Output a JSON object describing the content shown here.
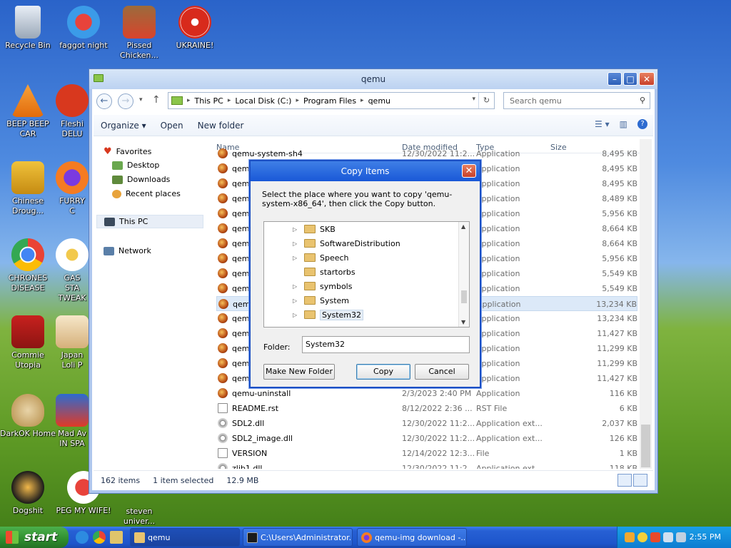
{
  "desktop": {
    "icons": [
      {
        "label": "Recycle Bin"
      },
      {
        "label": "faggot night"
      },
      {
        "label": "Pissed Chicken..."
      },
      {
        "label": "UKRAINE!"
      },
      {
        "label": "BEEP BEEP CAR"
      },
      {
        "label": "Fleshi DELU"
      },
      {
        "label": "Chinese Droug..."
      },
      {
        "label": "FURRY C"
      },
      {
        "label": "CHRONES DISEASE"
      },
      {
        "label": "GAS STA TWEAK"
      },
      {
        "label": "Commie Utopia"
      },
      {
        "label": "Japan Loli P"
      },
      {
        "label": "DarkOK Home"
      },
      {
        "label": "Mad Av IN SPA"
      },
      {
        "label": "Dogshit"
      },
      {
        "label": "PEG MY WIFE!"
      },
      {
        "label": "steven univer..."
      }
    ]
  },
  "explorer": {
    "title": "qemu",
    "breadcrumbs": [
      "This PC",
      "Local Disk (C:)",
      "Program Files",
      "qemu"
    ],
    "search_placeholder": "Search qemu",
    "toolbar": {
      "organize": "Organize",
      "open": "Open",
      "new_folder": "New folder"
    },
    "nav": {
      "favorites": "Favorites",
      "desktop": "Desktop",
      "downloads": "Downloads",
      "recent": "Recent places",
      "this_pc": "This PC",
      "network": "Network"
    },
    "columns": {
      "name": "Name",
      "date": "Date modified",
      "type": "Type",
      "size": "Size"
    },
    "rows": [
      {
        "name": "qemu-system-sh4",
        "date": "12/30/2022 11:2...",
        "type": "Application",
        "size": "8,495 KB",
        "icon": "qemu"
      },
      {
        "name": "qemu",
        "date": "",
        "type": "Application",
        "size": "8,495 KB",
        "icon": "qemu"
      },
      {
        "name": "qemu",
        "date": "",
        "type": "Application",
        "size": "8,495 KB",
        "icon": "qemu"
      },
      {
        "name": "qemu",
        "date": "",
        "type": "Application",
        "size": "8,489 KB",
        "icon": "qemu"
      },
      {
        "name": "qemu",
        "date": "",
        "type": "Application",
        "size": "5,956 KB",
        "icon": "qemu"
      },
      {
        "name": "qemu",
        "date": "",
        "type": "Application",
        "size": "8,664 KB",
        "icon": "qemu"
      },
      {
        "name": "qemu",
        "date": "",
        "type": "Application",
        "size": "8,664 KB",
        "icon": "qemu"
      },
      {
        "name": "qemu",
        "date": "",
        "type": "Application",
        "size": "5,956 KB",
        "icon": "qemu"
      },
      {
        "name": "qemu",
        "date": "",
        "type": "Application",
        "size": "5,549 KB",
        "icon": "qemu"
      },
      {
        "name": "qemu",
        "date": "",
        "type": "Application",
        "size": "5,549 KB",
        "icon": "qemu"
      },
      {
        "name": "qemu",
        "date": "",
        "type": "Application",
        "size": "13,234 KB",
        "icon": "qemu",
        "selected": true
      },
      {
        "name": "qemu",
        "date": "",
        "type": "Application",
        "size": "13,234 KB",
        "icon": "qemu"
      },
      {
        "name": "qemu",
        "date": "",
        "type": "Application",
        "size": "11,427 KB",
        "icon": "qemu"
      },
      {
        "name": "qemu",
        "date": "",
        "type": "Application",
        "size": "11,299 KB",
        "icon": "qemu"
      },
      {
        "name": "qemu",
        "date": "",
        "type": "Application",
        "size": "11,299 KB",
        "icon": "qemu"
      },
      {
        "name": "qemu",
        "date": "",
        "type": "Application",
        "size": "11,427 KB",
        "icon": "qemu"
      },
      {
        "name": "qemu-uninstall",
        "date": "2/3/2023 2:40 PM",
        "type": "Application",
        "size": "116 KB",
        "icon": "qemu"
      },
      {
        "name": "README.rst",
        "date": "8/12/2022 2:36 ...",
        "type": "RST File",
        "size": "6 KB",
        "icon": "doc"
      },
      {
        "name": "SDL2.dll",
        "date": "12/30/2022 11:2...",
        "type": "Application ext...",
        "size": "2,037 KB",
        "icon": "dll"
      },
      {
        "name": "SDL2_image.dll",
        "date": "12/30/2022 11:2...",
        "type": "Application ext...",
        "size": "126 KB",
        "icon": "dll"
      },
      {
        "name": "VERSION",
        "date": "12/14/2022 12:3...",
        "type": "File",
        "size": "1 KB",
        "icon": "doc"
      },
      {
        "name": "zlib1.dll",
        "date": "12/30/2022 11:2...",
        "type": "Application ext...",
        "size": "118 KB",
        "icon": "dll"
      }
    ],
    "status": {
      "count": "162 items",
      "selected": "1 item selected",
      "size": "12.9 MB"
    }
  },
  "dialog": {
    "title": "Copy Items",
    "instruction": "Select the place where you want to copy 'qemu-system-x86_64', then click the Copy button.",
    "tree": [
      {
        "label": "SKB",
        "expandable": true
      },
      {
        "label": "SoftwareDistribution",
        "expandable": true
      },
      {
        "label": "Speech",
        "expandable": true
      },
      {
        "label": "startorbs",
        "expandable": false
      },
      {
        "label": "symbols",
        "expandable": true
      },
      {
        "label": "System",
        "expandable": true
      },
      {
        "label": "System32",
        "expandable": true,
        "selected": true
      }
    ],
    "folder_label": "Folder:",
    "folder_value": "System32",
    "buttons": {
      "make_new_folder": "Make New Folder",
      "copy": "Copy",
      "cancel": "Cancel"
    }
  },
  "taskbar": {
    "start": "start",
    "tasks": [
      {
        "label": "qemu",
        "active": true
      },
      {
        "label": "C:\\Users\\Administrator...",
        "active": false
      },
      {
        "label": "qemu-img download -...",
        "active": false
      }
    ],
    "clock": "2:55 PM"
  },
  "colors": {
    "accent": "#1958d7",
    "selection": "#dce9f8",
    "folder": "#e9c36f"
  }
}
